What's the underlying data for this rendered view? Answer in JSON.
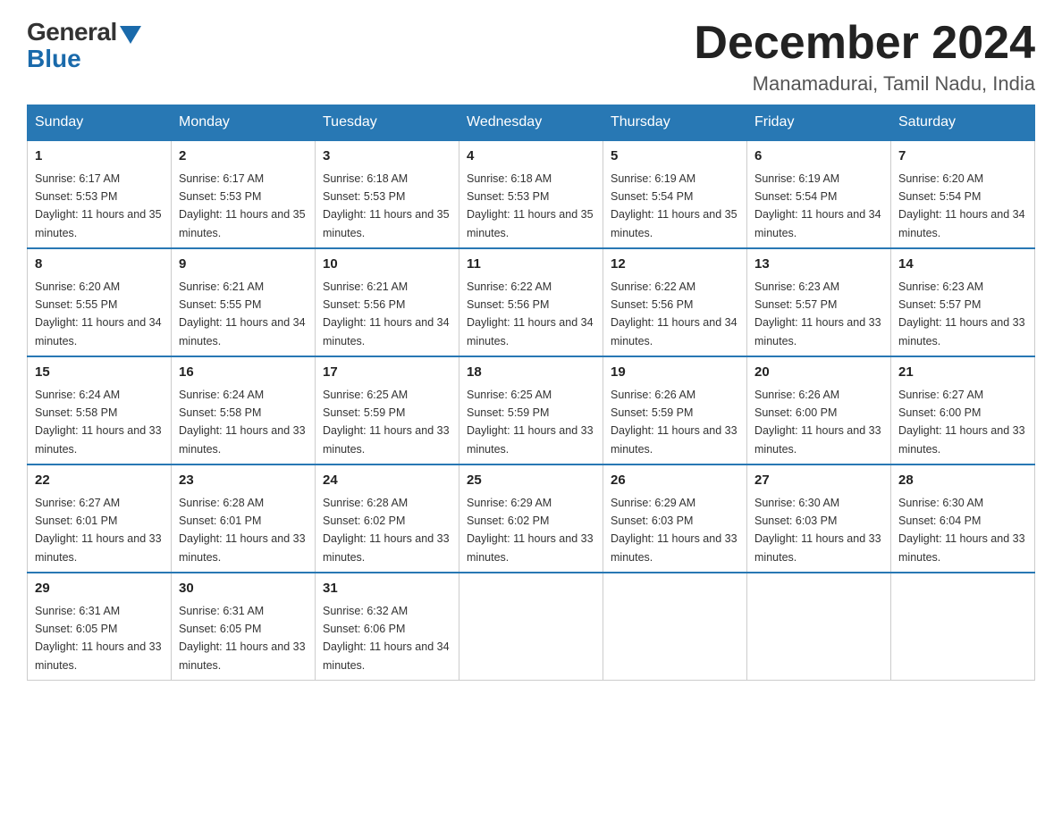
{
  "header": {
    "logo_general": "General",
    "logo_blue": "Blue",
    "month_title": "December 2024",
    "location": "Manamadurai, Tamil Nadu, India"
  },
  "days_of_week": [
    "Sunday",
    "Monday",
    "Tuesday",
    "Wednesday",
    "Thursday",
    "Friday",
    "Saturday"
  ],
  "weeks": [
    [
      {
        "day": "1",
        "sunrise": "6:17 AM",
        "sunset": "5:53 PM",
        "daylight": "11 hours and 35 minutes."
      },
      {
        "day": "2",
        "sunrise": "6:17 AM",
        "sunset": "5:53 PM",
        "daylight": "11 hours and 35 minutes."
      },
      {
        "day": "3",
        "sunrise": "6:18 AM",
        "sunset": "5:53 PM",
        "daylight": "11 hours and 35 minutes."
      },
      {
        "day": "4",
        "sunrise": "6:18 AM",
        "sunset": "5:53 PM",
        "daylight": "11 hours and 35 minutes."
      },
      {
        "day": "5",
        "sunrise": "6:19 AM",
        "sunset": "5:54 PM",
        "daylight": "11 hours and 35 minutes."
      },
      {
        "day": "6",
        "sunrise": "6:19 AM",
        "sunset": "5:54 PM",
        "daylight": "11 hours and 34 minutes."
      },
      {
        "day": "7",
        "sunrise": "6:20 AM",
        "sunset": "5:54 PM",
        "daylight": "11 hours and 34 minutes."
      }
    ],
    [
      {
        "day": "8",
        "sunrise": "6:20 AM",
        "sunset": "5:55 PM",
        "daylight": "11 hours and 34 minutes."
      },
      {
        "day": "9",
        "sunrise": "6:21 AM",
        "sunset": "5:55 PM",
        "daylight": "11 hours and 34 minutes."
      },
      {
        "day": "10",
        "sunrise": "6:21 AM",
        "sunset": "5:56 PM",
        "daylight": "11 hours and 34 minutes."
      },
      {
        "day": "11",
        "sunrise": "6:22 AM",
        "sunset": "5:56 PM",
        "daylight": "11 hours and 34 minutes."
      },
      {
        "day": "12",
        "sunrise": "6:22 AM",
        "sunset": "5:56 PM",
        "daylight": "11 hours and 34 minutes."
      },
      {
        "day": "13",
        "sunrise": "6:23 AM",
        "sunset": "5:57 PM",
        "daylight": "11 hours and 33 minutes."
      },
      {
        "day": "14",
        "sunrise": "6:23 AM",
        "sunset": "5:57 PM",
        "daylight": "11 hours and 33 minutes."
      }
    ],
    [
      {
        "day": "15",
        "sunrise": "6:24 AM",
        "sunset": "5:58 PM",
        "daylight": "11 hours and 33 minutes."
      },
      {
        "day": "16",
        "sunrise": "6:24 AM",
        "sunset": "5:58 PM",
        "daylight": "11 hours and 33 minutes."
      },
      {
        "day": "17",
        "sunrise": "6:25 AM",
        "sunset": "5:59 PM",
        "daylight": "11 hours and 33 minutes."
      },
      {
        "day": "18",
        "sunrise": "6:25 AM",
        "sunset": "5:59 PM",
        "daylight": "11 hours and 33 minutes."
      },
      {
        "day": "19",
        "sunrise": "6:26 AM",
        "sunset": "5:59 PM",
        "daylight": "11 hours and 33 minutes."
      },
      {
        "day": "20",
        "sunrise": "6:26 AM",
        "sunset": "6:00 PM",
        "daylight": "11 hours and 33 minutes."
      },
      {
        "day": "21",
        "sunrise": "6:27 AM",
        "sunset": "6:00 PM",
        "daylight": "11 hours and 33 minutes."
      }
    ],
    [
      {
        "day": "22",
        "sunrise": "6:27 AM",
        "sunset": "6:01 PM",
        "daylight": "11 hours and 33 minutes."
      },
      {
        "day": "23",
        "sunrise": "6:28 AM",
        "sunset": "6:01 PM",
        "daylight": "11 hours and 33 minutes."
      },
      {
        "day": "24",
        "sunrise": "6:28 AM",
        "sunset": "6:02 PM",
        "daylight": "11 hours and 33 minutes."
      },
      {
        "day": "25",
        "sunrise": "6:29 AM",
        "sunset": "6:02 PM",
        "daylight": "11 hours and 33 minutes."
      },
      {
        "day": "26",
        "sunrise": "6:29 AM",
        "sunset": "6:03 PM",
        "daylight": "11 hours and 33 minutes."
      },
      {
        "day": "27",
        "sunrise": "6:30 AM",
        "sunset": "6:03 PM",
        "daylight": "11 hours and 33 minutes."
      },
      {
        "day": "28",
        "sunrise": "6:30 AM",
        "sunset": "6:04 PM",
        "daylight": "11 hours and 33 minutes."
      }
    ],
    [
      {
        "day": "29",
        "sunrise": "6:31 AM",
        "sunset": "6:05 PM",
        "daylight": "11 hours and 33 minutes."
      },
      {
        "day": "30",
        "sunrise": "6:31 AM",
        "sunset": "6:05 PM",
        "daylight": "11 hours and 33 minutes."
      },
      {
        "day": "31",
        "sunrise": "6:32 AM",
        "sunset": "6:06 PM",
        "daylight": "11 hours and 34 minutes."
      },
      null,
      null,
      null,
      null
    ]
  ]
}
